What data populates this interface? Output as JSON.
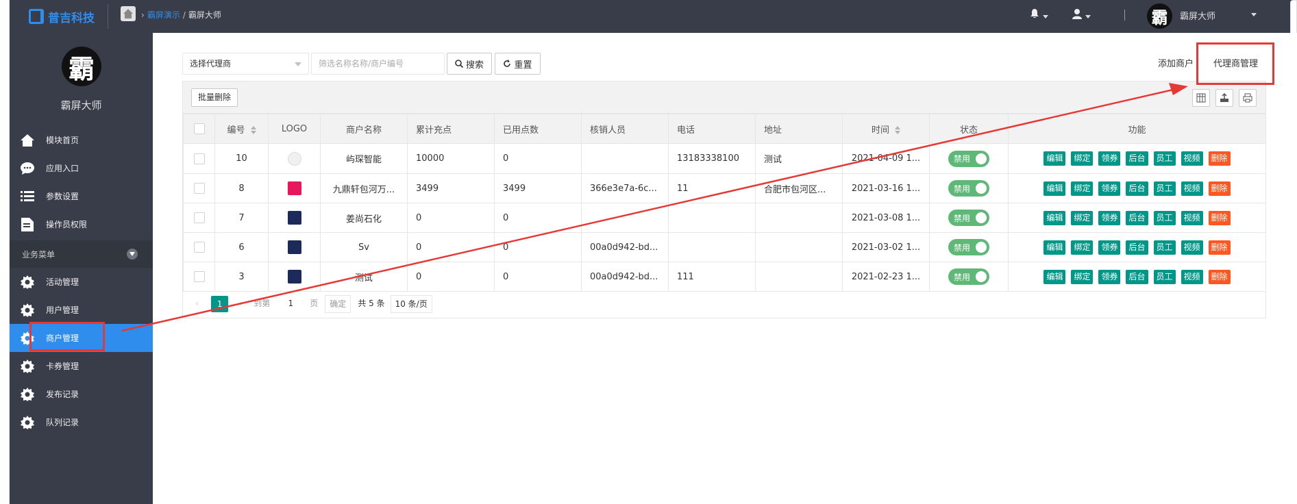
{
  "topbar": {
    "brand": "普吉科技",
    "breadcrumb": {
      "link": "霸屏演示",
      "sep": "/",
      "current": "霸屏大师"
    },
    "user_name": "霸屏大师",
    "avatar_char": "霸"
  },
  "sidebar": {
    "avatar_char": "霸",
    "name": "霸屏大师",
    "items": [
      {
        "label": "模块首页",
        "icon": "home-icon"
      },
      {
        "label": "应用入口",
        "icon": "chat-icon"
      },
      {
        "label": "参数设置",
        "icon": "list-icon"
      },
      {
        "label": "操作员权限",
        "icon": "document-icon"
      }
    ],
    "group_label": "业务菜单",
    "biz_items": [
      {
        "label": "活动管理",
        "icon": "gear-icon"
      },
      {
        "label": "用户管理",
        "icon": "gear-icon"
      },
      {
        "label": "商户管理",
        "icon": "gear-icon",
        "active": true
      },
      {
        "label": "卡券管理",
        "icon": "gear-icon"
      },
      {
        "label": "发布记录",
        "icon": "gear-icon"
      },
      {
        "label": "队列记录",
        "icon": "gear-icon"
      }
    ]
  },
  "filters": {
    "agent_select": "选择代理商",
    "search_placeholder": "筛选名称名称/商户编号",
    "search_btn": "搜索",
    "reset_btn": "重置"
  },
  "top_links": {
    "add": "添加商户",
    "agent": "代理商管理"
  },
  "toolbar": {
    "batch_delete": "批量删除"
  },
  "table": {
    "columns": [
      "编号",
      "LOGO",
      "商户名称",
      "累计充点",
      "已用点数",
      "核销人员",
      "电话",
      "地址",
      "时间",
      "状态",
      "功能"
    ],
    "rows": [
      {
        "id": "10",
        "logo_color": "#f0f0f0",
        "name": "屿琛智能",
        "total": "10000",
        "used": "0",
        "staff": "",
        "phone": "13183338100",
        "addr": "测试",
        "time": "2021-04-09 1...",
        "status": "禁用"
      },
      {
        "id": "8",
        "logo_color": "#e8175d",
        "name": "九鼎轩包河万...",
        "total": "3499",
        "used": "3499",
        "staff": "366e3e7a-6c...",
        "phone": "11",
        "addr": "合肥市包河区...",
        "time": "2021-03-16 1...",
        "status": "禁用"
      },
      {
        "id": "7",
        "logo_color": "#1c2a5a",
        "name": "姜尚石化",
        "total": "0",
        "used": "0",
        "staff": "",
        "phone": "",
        "addr": "",
        "time": "2021-03-08 1...",
        "status": "禁用"
      },
      {
        "id": "6",
        "logo_color": "#1c2a5a",
        "name": "Sv",
        "total": "0",
        "used": "0",
        "staff": "00a0d942-bd...",
        "phone": "",
        "addr": "",
        "time": "2021-03-02 1...",
        "status": "禁用"
      },
      {
        "id": "3",
        "logo_color": "#1c2a5a",
        "name": "测试",
        "total": "0",
        "used": "0",
        "staff": "00a0d942-bd...",
        "phone": "111",
        "addr": "",
        "time": "2021-02-23 1...",
        "status": "禁用"
      }
    ],
    "actions": [
      "编辑",
      "绑定",
      "领券",
      "后台",
      "员工",
      "视频",
      "删除"
    ]
  },
  "pager": {
    "current": "1",
    "goto_label": "到第",
    "goto_value": "1",
    "page_label": "页",
    "confirm": "确定",
    "total": "共 5 条",
    "per_page": "10 条/页"
  }
}
